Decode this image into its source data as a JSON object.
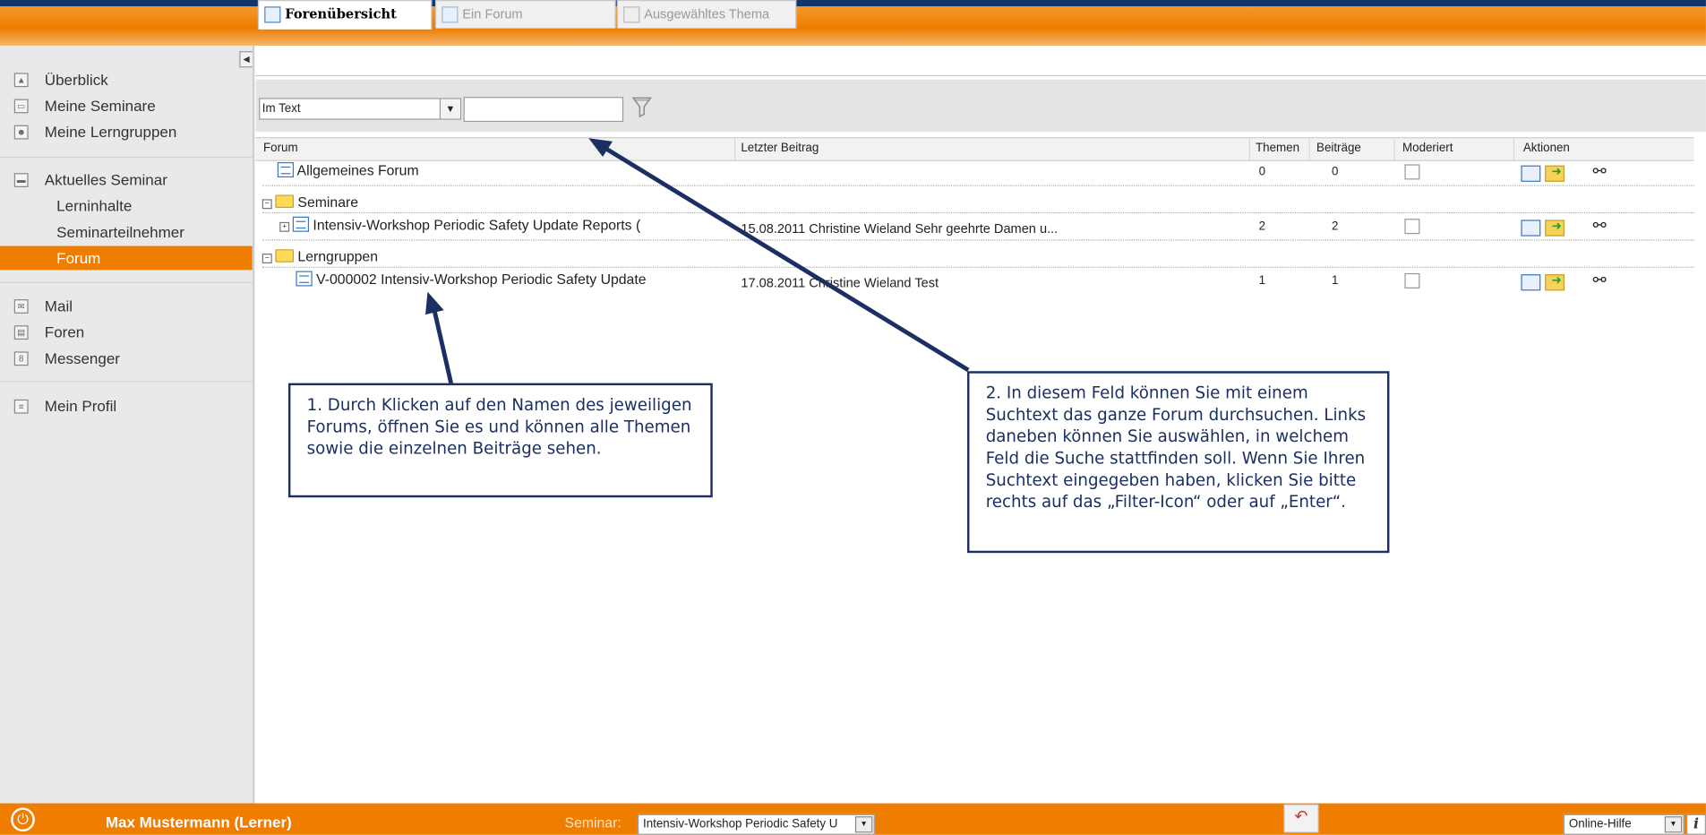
{
  "sidebar": {
    "items": [
      {
        "label": "Überblick",
        "icon": "home-icon"
      },
      {
        "label": "Meine Seminare",
        "icon": "seminar-icon"
      },
      {
        "label": "Meine Lerngruppen",
        "icon": "group-icon"
      },
      {
        "label": "Aktuelles Seminar",
        "icon": "monitor-icon"
      },
      {
        "label": "Lerninhalte"
      },
      {
        "label": "Seminarteilnehmer"
      },
      {
        "label": "Forum"
      },
      {
        "label": "Mail",
        "icon": "mail-icon"
      },
      {
        "label": "Foren",
        "icon": "forum-icon"
      },
      {
        "label": "Messenger",
        "icon": "messenger-icon"
      },
      {
        "label": "Mein Profil",
        "icon": "profile-icon"
      }
    ],
    "active_item": "Forum"
  },
  "tabs": [
    {
      "label": "Forenübersicht",
      "active": true
    },
    {
      "label": "Ein Forum",
      "active": false
    },
    {
      "label": "Ausgewähltes Thema",
      "active": false
    }
  ],
  "filter": {
    "field_select": "Im Text",
    "search_value": ""
  },
  "table": {
    "headers": [
      "Forum",
      "Letzter Beitrag",
      "Themen",
      "Beiträge",
      "Moderiert",
      "Aktionen"
    ],
    "rows": [
      {
        "name": "Allgemeines Forum",
        "last": "",
        "themen": "0",
        "beitraege": "0"
      },
      {
        "group": "Seminare"
      },
      {
        "name": "Intensiv-Workshop Periodic Safety Update Reports (",
        "last": "15.08.2011 Christine Wieland Sehr geehrte Damen u...",
        "themen": "2",
        "beitraege": "2"
      },
      {
        "group": "Lerngruppen"
      },
      {
        "name": "V-000002 Intensiv-Workshop Periodic Safety Update",
        "last": "17.08.2011 Christine Wieland Test",
        "themen": "1",
        "beitraege": "1"
      }
    ]
  },
  "callouts": {
    "c1": "1. Durch Klicken auf den Namen des jeweiligen Forums, öffnen Sie es und können alle Themen sowie die einzelnen Beiträge sehen.",
    "c2": "2. In diesem Feld können Sie mit einem Suchtext das ganze Forum durchsuchen. Links daneben können Sie auswählen, in welchem Feld die Suche stattfinden soll. Wenn Sie Ihren Suchtext eingegeben haben, klicken Sie bitte rechts auf das „Filter-Icon“ oder auf „Enter“."
  },
  "footer": {
    "user": "Max Mustermann (Lerner)",
    "seminar_label": "Seminar:",
    "seminar_value": "Intensiv-Workshop Periodic Safety U",
    "help_value": "Online-Hilfe",
    "info_glyph": "i"
  },
  "colors": {
    "accent": "#ef7d00",
    "navy": "#14336b",
    "callout": "#1b2f63"
  }
}
